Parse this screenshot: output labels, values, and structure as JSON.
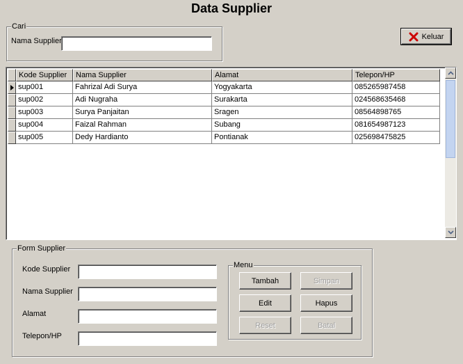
{
  "window": {
    "title": "Data Supplier"
  },
  "search": {
    "group_label": "Cari",
    "field_label": "Nama Supplier",
    "value": "",
    "placeholder": ""
  },
  "close_button": {
    "label": "Keluar",
    "icon": "x-icon",
    "icon_color": "#cc0000"
  },
  "grid": {
    "columns": [
      "Kode Supplier",
      "Nama Supplier",
      "Alamat",
      "Telepon/HP"
    ],
    "rows": [
      [
        "sup001",
        "Fahrizal Adi Surya",
        "Yogyakarta",
        "085265987458"
      ],
      [
        "sup002",
        "Adi Nugraha",
        "Surakarta",
        "024568635468"
      ],
      [
        "sup003",
        "Surya Panjaitan",
        "Sragen",
        "08564898765"
      ],
      [
        "sup004",
        "Faizal Rahman",
        "Subang",
        "081654987123"
      ],
      [
        "sup005",
        "Dedy Hardianto",
        "Pontianak",
        "025698475825"
      ]
    ],
    "selected_row": 0
  },
  "form": {
    "group_label": "Form Supplier",
    "fields": [
      {
        "label": "Kode Supplier",
        "value": ""
      },
      {
        "label": "Nama Supplier",
        "value": ""
      },
      {
        "label": "Alamat",
        "value": ""
      },
      {
        "label": "Telepon/HP",
        "value": ""
      }
    ]
  },
  "menu": {
    "group_label": "Menu",
    "buttons": {
      "tambah": {
        "label": "Tambah",
        "enabled": true
      },
      "simpan": {
        "label": "Simpan",
        "enabled": false
      },
      "edit": {
        "label": "Edit",
        "enabled": true
      },
      "hapus": {
        "label": "Hapus",
        "enabled": true
      },
      "reset": {
        "label": "Reset",
        "enabled": false
      },
      "batal": {
        "label": "Batal",
        "enabled": false
      }
    }
  }
}
